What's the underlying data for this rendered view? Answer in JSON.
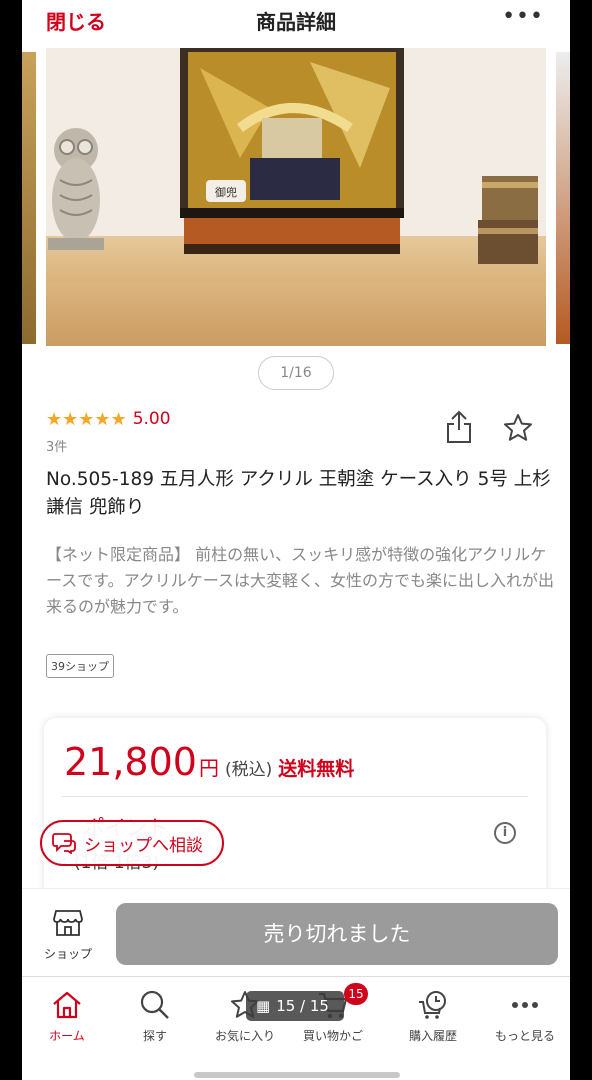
{
  "header": {
    "close_label": "閉じる",
    "title": "商品詳細",
    "more_label": "•••"
  },
  "gallery": {
    "counter": "1/16",
    "engraving": "御兜"
  },
  "rating": {
    "stars": "★★★★★",
    "value": "5.00",
    "count": "3件"
  },
  "product": {
    "title": "No.505-189 五月人形 アクリル 王朝塗 ケース入り 5号 上杉謙信 兜飾り",
    "description": "【ネット限定商品】 前柱の無い、スッキリ感が特徴の強化アクリルケースです。アクリルケースは大変軽く、女性の方でも楽に出し入れが出来るのが魅力です。",
    "shop_badge": "39ショップ"
  },
  "price": {
    "amount": "21,800",
    "yen": "円",
    "tax": "(税込)",
    "shipping": "送料無料",
    "point_partial": "ポイント",
    "point_sub_partial": "(1倍 1倍3)"
  },
  "consult": {
    "label": "ショップへ相談"
  },
  "action_bar": {
    "shop_label": "ショップ",
    "soldout_label": "売り切れました"
  },
  "tabs": [
    {
      "label": "ホーム"
    },
    {
      "label": "探す"
    },
    {
      "label": "お気に入り"
    },
    {
      "label": "買い物かご",
      "badge": "15"
    },
    {
      "label": "購入履歴"
    },
    {
      "label": "もっと見る"
    }
  ],
  "page_indicator": {
    "text": "15 / 15"
  },
  "colors": {
    "accent": "#d0021b",
    "star": "#f5a623",
    "disabled": "#9b9b9b"
  }
}
